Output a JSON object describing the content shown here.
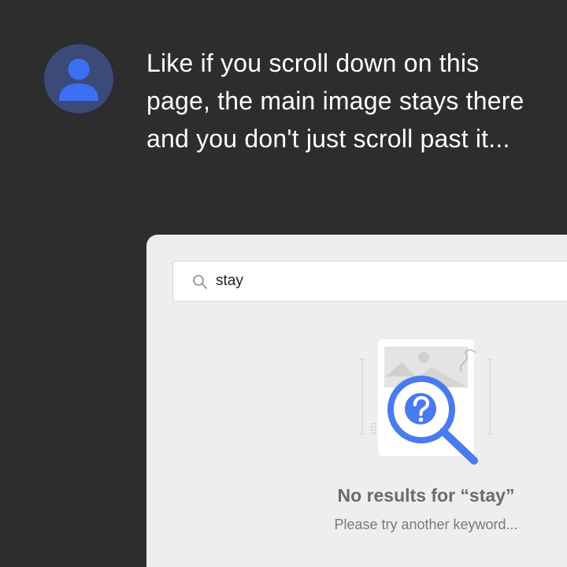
{
  "message": {
    "text": "Like if you scroll down on this page, the main image stays there and you don't just scroll past it..."
  },
  "avatar": {
    "icon": "user-icon",
    "background": "#3b4a78",
    "color": "#3d6ff5"
  },
  "search": {
    "value": "stay",
    "icon": "search-icon"
  },
  "empty_state": {
    "icon": "no-results-magnifier-icon",
    "accent": "#4a7af0",
    "title": "No results for “stay”",
    "subtitle": "Please try another keyword..."
  }
}
